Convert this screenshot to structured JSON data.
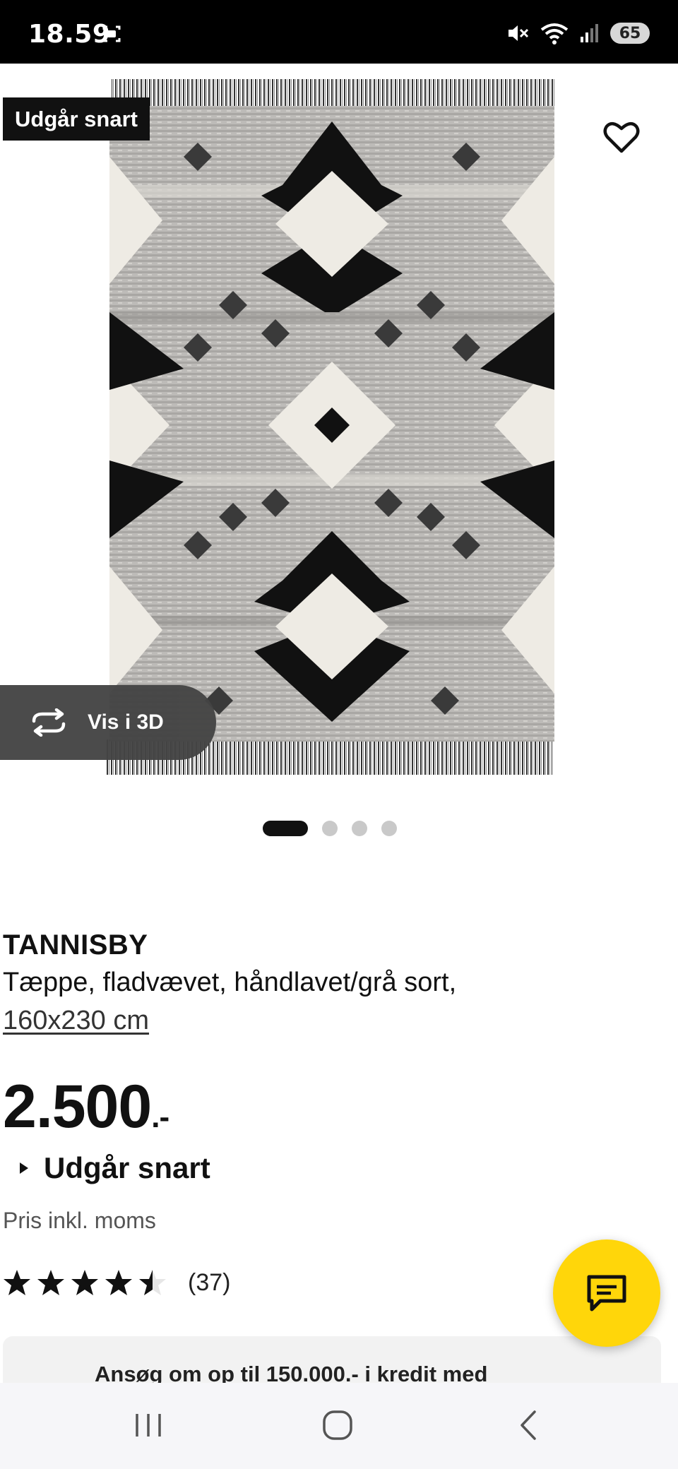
{
  "status_bar": {
    "time": "18.59",
    "battery": "65"
  },
  "product": {
    "badge": "Udgår snart",
    "view_3d_label": "Vis i 3D",
    "name": "TANNISBY",
    "description": "Tæppe, fladvævet, håndlavet/grå sort,",
    "size": "160x230 cm",
    "price_main": "2.500",
    "price_suffix": ".-",
    "availability": "Udgår snart",
    "vat_note": "Pris inkl. moms",
    "rating_value": 4.5,
    "rating_max": 5,
    "rating_count": "(37)"
  },
  "gallery": {
    "image_count": 4,
    "active_index": 0
  },
  "credit_banner": {
    "text": "Ansøg om op til 150.000.- i kredit med"
  },
  "colors": {
    "accent_yellow": "#ffd60a",
    "badge_bg": "#111111",
    "text_primary": "#111111"
  },
  "icons": {
    "favorite": "heart-outline-icon",
    "view_3d": "rotate-3d-icon",
    "chat": "chat-bubble-icon",
    "nav_recents": "recents-icon",
    "nav_home": "home-icon",
    "nav_back": "back-icon"
  }
}
